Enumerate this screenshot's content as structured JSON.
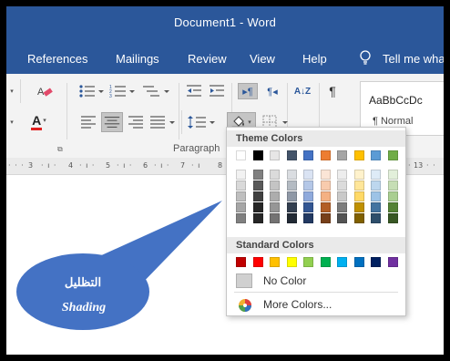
{
  "window": {
    "title": "Document1  -  Word"
  },
  "tabs": [
    "References",
    "Mailings",
    "Review",
    "View",
    "Help"
  ],
  "tell_me": "Tell me wha",
  "ribbon": {
    "group_label": "Paragraph",
    "pilcrow": "¶",
    "sort_label": "A↓Z",
    "font_color_letter": "A"
  },
  "style_gallery": {
    "sample": "AaBbCcDc",
    "name": "¶ Normal"
  },
  "ruler": {
    "ticks": [
      "3",
      "4",
      "5",
      "6",
      "7",
      "8",
      "13"
    ]
  },
  "shading_menu": {
    "theme_header": "Theme Colors",
    "standard_header": "Standard Colors",
    "no_color": "No Color",
    "more_colors": "More Colors...",
    "theme_colors": [
      "#ffffff",
      "#000000",
      "#e7e6e6",
      "#44546a",
      "#4472c4",
      "#ed7d31",
      "#a5a5a5",
      "#ffc000",
      "#5b9bd5",
      "#70ad47"
    ],
    "standard_colors": [
      "#c00000",
      "#ff0000",
      "#ffc000",
      "#ffff00",
      "#92d050",
      "#00b050",
      "#00b0f0",
      "#0070c0",
      "#002060",
      "#7030a0"
    ]
  },
  "callout": {
    "arabic": "التظليل",
    "english": "Shading",
    "color": "#4472c4"
  },
  "colors": {
    "title_bar": "#2b579a",
    "ribbon_bg": "#f3f3f3"
  }
}
